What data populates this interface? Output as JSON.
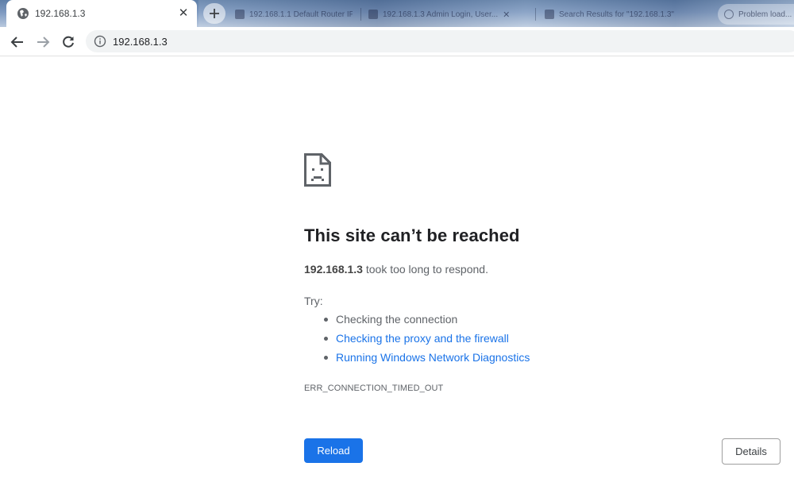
{
  "browser": {
    "active_tab": {
      "title": "192.168.1.3",
      "favicon": "globe-icon"
    },
    "background_tabs": [
      {
        "title": "192.168.1.1 Default Router IP"
      },
      {
        "title": "192.168.1.3 Admin Login, User..."
      },
      {
        "title": "Search Results for \"192.168.1.3\""
      },
      {
        "title": "Problem load..."
      }
    ],
    "address_bar": {
      "url": "192.168.1.3"
    }
  },
  "error_page": {
    "icon": "sad-page-icon",
    "heading": "This site can’t be reached",
    "host": "192.168.1.3",
    "message": " took too long to respond.",
    "try_label": "Try:",
    "suggestions": {
      "check_connection": "Checking the connection",
      "check_proxy": "Checking the proxy and the firewall",
      "run_diagnostics": "Running Windows Network Diagnostics"
    },
    "error_code": "ERR_CONNECTION_TIMED_OUT",
    "reload_label": "Reload",
    "details_label": "Details"
  },
  "colors": {
    "link": "#1a73e8",
    "primary_button": "#1a73e8",
    "text": "#202124",
    "secondary_text": "#5f6368"
  }
}
